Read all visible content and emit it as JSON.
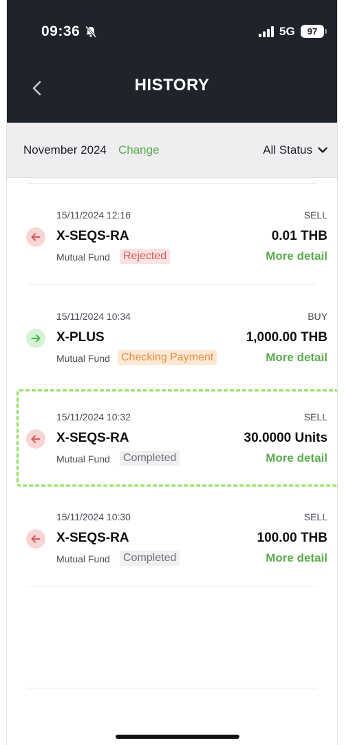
{
  "status_bar": {
    "time": "09:36",
    "network": "5G",
    "battery": "97",
    "icons": [
      "bell-slash-icon",
      "cell-signal-icon"
    ]
  },
  "header": {
    "title": "HISTORY",
    "back_icon": "chevron-left-icon"
  },
  "filter": {
    "month": "November 2024",
    "change_label": "Change",
    "status_label": "All Status",
    "status_icon": "chevron-down-icon"
  },
  "transactions": [
    {
      "datetime": "15/11/2024 12:16",
      "side": "SELL",
      "direction": "sell",
      "fund": "X-SEQS-RA",
      "amount": "0.01 THB",
      "type": "Mutual Fund",
      "status": "Rejected",
      "more": "More detail"
    },
    {
      "datetime": "15/11/2024 10:34",
      "side": "BUY",
      "direction": "buy",
      "fund": "X-PLUS",
      "amount": "1,000.00 THB",
      "type": "Mutual Fund",
      "status": "Checking Payment",
      "more": "More detail"
    },
    {
      "datetime": "15/11/2024 10:32",
      "side": "SELL",
      "direction": "sell",
      "fund": "X-SEQS-RA",
      "amount": "30.0000 Units",
      "type": "Mutual Fund",
      "status": "Completed",
      "more": "More detail"
    },
    {
      "datetime": "15/11/2024 10:30",
      "side": "SELL",
      "direction": "sell",
      "fund": "X-SEQS-RA",
      "amount": "100.00 THB",
      "type": "Mutual Fund",
      "status": "Completed",
      "more": "More detail"
    }
  ],
  "colors": {
    "header_bg": "#1f232b",
    "accent_green": "#5bab4e",
    "sell_red": "#d65a5a",
    "buy_green": "#3dbb4f",
    "highlight": "#8ee05f"
  }
}
